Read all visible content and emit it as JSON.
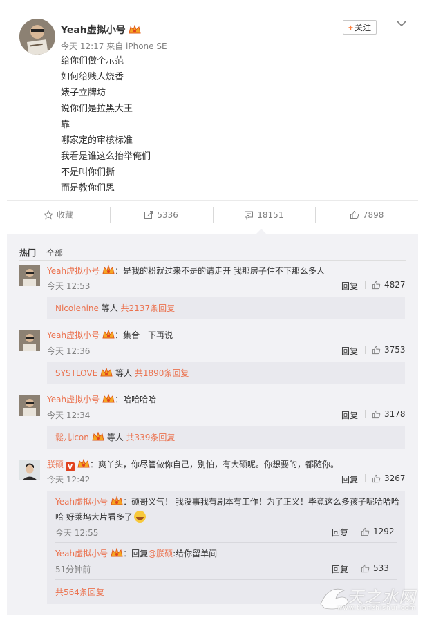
{
  "post": {
    "author": "Yeah虚拟小号",
    "meta": "今天 12:17 来自 iPhone SE",
    "follow_label": "关注",
    "follow_plus": "+",
    "lines": [
      "给你们做个示范",
      "如何给贱人烧香",
      "婊子立牌坊",
      "说你们是拉黑大王",
      "靠",
      "哪家定的审核标准",
      "我看是谁这么抬举俺们",
      "不是叫你们撕",
      "而是教你们思"
    ],
    "actions": {
      "favorite": "收藏",
      "repost": "5336",
      "comment": "18151",
      "like": "7898"
    }
  },
  "comments_section": {
    "tab_hot": "热门",
    "tab_all": "全部",
    "comments": [
      {
        "name": "Yeah虚拟小号",
        "text": "：是我的粉就过来不是的请走开 我那房子住不下那么多人",
        "time": "今天 12:53",
        "reply": "回复",
        "likes": "4827",
        "summary_user": "Nicolenine",
        "summary_mid": " 等人 ",
        "summary_count": "共2137条回复"
      },
      {
        "name": "Yeah虚拟小号",
        "text": "：集合一下再说",
        "time": "今天 12:36",
        "reply": "回复",
        "likes": "3753",
        "summary_user": "SYSTLOVE",
        "summary_mid": " 等人 ",
        "summary_count": "共1890条回复"
      },
      {
        "name": "Yeah虚拟小号",
        "text": "：哈哈哈哈",
        "time": "今天 12:34",
        "reply": "回复",
        "likes": "3178",
        "summary_user": "鬆儿icon",
        "summary_mid": " 等人 ",
        "summary_count": "共339条回复"
      },
      {
        "name": "朕硕",
        "verified_mark": "V",
        "text": "：爽丫头，你尽管做你自己，别怕，有大硕呢。你想要的，都随你。",
        "time": "今天 12:42",
        "reply": "回复",
        "likes": "3267",
        "sub_replies": [
          {
            "name": "Yeah虚拟小号",
            "text_1": "：硕哥义气！ 我没事我有剧本有工作！为了正义！毕竟这么多孩子呢哈哈哈",
            "text_2": "哈 好莱坞大片看多了",
            "time": "今天 12:55",
            "reply": "回复",
            "likes": "1292"
          },
          {
            "name": "Yeah虚拟小号",
            "text_prefix": "：回复",
            "mention": "@朕硕",
            "text_suffix": ":给你留单间",
            "time": "51分钟前",
            "reply": "回复",
            "likes": "533"
          }
        ],
        "total_replies": "共564条回复"
      }
    ]
  },
  "watermark": {
    "logo_text": "天之水网",
    "url": "www.tianzhishui.com"
  },
  "colors": {
    "accent": "#eb7350",
    "follow_plus": "#ff8140",
    "comments_bg": "#f2f2f5",
    "sub_bg": "#e9e9ee"
  }
}
